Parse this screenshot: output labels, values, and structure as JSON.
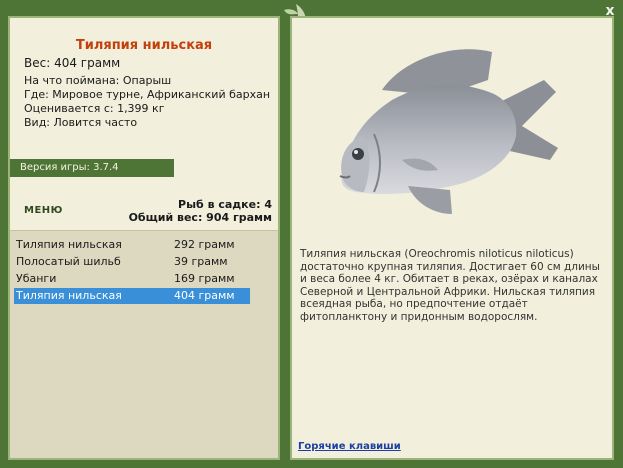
{
  "fish": {
    "title": "Тиляпия нильская",
    "weight": "Вес: 404 грамм",
    "caught_on": "На что поймана: Опарыш",
    "location": "Где: Мировое турне, Африканский бархан",
    "valued_from": "Оценивается с: 1,399 кг",
    "kind": "Вид: Ловится часто",
    "description": "Тиляпия нильская (Oreochromis niloticus niloticus) достаточно крупная тиляпия. Достигает 60 см длины и веса более 4 кг. Обитает в реках, озёрах и каналах Северной и Центральной Африки. Нильская тиляпия всеядная рыба, но предпочтение отдаёт фитопланктону и придонным водорослям."
  },
  "version": "Версия игры: 3.7.4",
  "menu_label": "МЕНЮ",
  "stats": {
    "fish_in_keepnet": "Рыб в садке: 4",
    "total_weight": "Общий вес: 904 грамм"
  },
  "catch_list": [
    {
      "name": "Тиляпия нильская",
      "weight": "292 грамм"
    },
    {
      "name": "Полосатый шильб",
      "weight": "39 грамм"
    },
    {
      "name": "Убанги",
      "weight": "169 грамм"
    },
    {
      "name": "Тиляпия нильская",
      "weight": "404 грамм",
      "selected": true
    }
  ],
  "hotkeys_label": "Горячие клавиши",
  "close_label": "x",
  "colors": {
    "background": "#4e7436",
    "panel": "#f2f0dc",
    "title": "#c2410c",
    "selection": "#3a8fd9"
  },
  "icons": {
    "close": "close-icon",
    "logo": "fish-logo-icon"
  }
}
